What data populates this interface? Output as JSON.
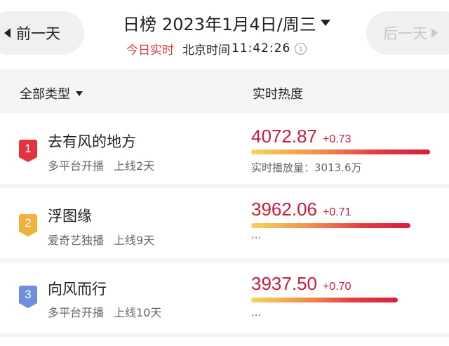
{
  "header": {
    "prev_label": "前一天",
    "next_label": "后一天",
    "title": "日榜",
    "date": "2023年1月4日/周三",
    "live_label": "今日实时",
    "beijing_label": "北京时间",
    "clock": "11:42:26"
  },
  "columns": {
    "type_label": "全部类型",
    "heat_label": "实时热度"
  },
  "colors": {
    "accent_red": "#c81e3a",
    "rank1_badge": "#e0353f",
    "rank2_badge": "#f0b13d",
    "rank3_badge": "#6f8fd8"
  },
  "rows": [
    {
      "rank": "1",
      "title": "去有风的地方",
      "platform": "多平台开播",
      "online": "上线2天",
      "heat": "4072.87",
      "delta": "+0.73",
      "extra": "实时播放量：3013.6万",
      "bar_ratio": 1.0
    },
    {
      "rank": "2",
      "title": "浮图缘",
      "platform": "爱奇艺独播",
      "online": "上线9天",
      "heat": "3962.06",
      "delta": "+0.71",
      "extra": "···",
      "bar_ratio": 0.89
    },
    {
      "rank": "3",
      "title": "向风而行",
      "platform": "多平台开播",
      "online": "上线10天",
      "heat": "3937.50",
      "delta": "+0.70",
      "extra": "...",
      "bar_ratio": 0.82
    }
  ]
}
